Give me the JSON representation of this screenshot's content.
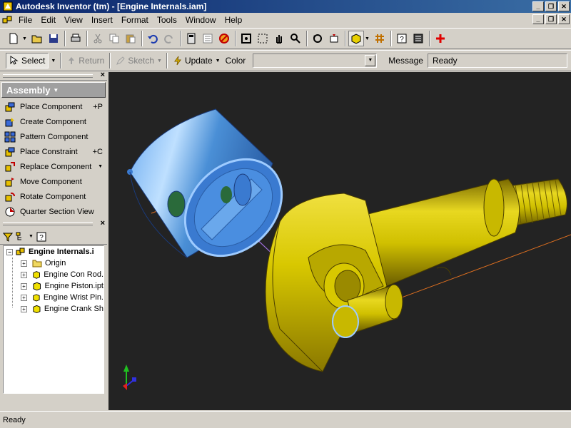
{
  "window": {
    "title": "Autodesk Inventor (tm) - [Engine Internals.iam]",
    "controls": [
      "_",
      "❐",
      "✕"
    ]
  },
  "menu": {
    "items": [
      "File",
      "Edit",
      "View",
      "Insert",
      "Format",
      "Tools",
      "Window",
      "Help"
    ]
  },
  "toolbar2": {
    "select_label": "Select",
    "return_label": "Return",
    "sketch_label": "Sketch",
    "update_label": "Update",
    "color_label": "Color",
    "color_value": "",
    "message_label": "Message",
    "message_value": "Ready"
  },
  "panel": {
    "header": "Assembly",
    "items": [
      {
        "label": "Place Component",
        "shortcut": "+P",
        "icon": "place-component-icon"
      },
      {
        "label": "Create Component",
        "shortcut": "",
        "icon": "create-component-icon"
      },
      {
        "label": "Pattern Component",
        "shortcut": "",
        "icon": "pattern-component-icon"
      },
      {
        "label": "Place Constraint",
        "shortcut": "+C",
        "icon": "place-constraint-icon"
      },
      {
        "label": "Replace Component",
        "shortcut": "",
        "icon": "replace-component-icon"
      },
      {
        "label": "Move Component",
        "shortcut": "",
        "icon": "move-component-icon"
      },
      {
        "label": "Rotate Component",
        "shortcut": "",
        "icon": "rotate-component-icon"
      },
      {
        "label": "Quarter Section View",
        "shortcut": "",
        "icon": "section-view-icon"
      }
    ]
  },
  "browser": {
    "root": "Engine Internals.i",
    "children": [
      "Origin",
      "Engine Con Rod.",
      "Engine Piston.ipt",
      "Engine Wrist Pin.",
      "Engine Crank Sh"
    ]
  },
  "colors": {
    "piston": "#4a8fd6",
    "crank": "#d4c400",
    "viewport_bg": "#232323"
  },
  "status": {
    "text": "Ready"
  }
}
